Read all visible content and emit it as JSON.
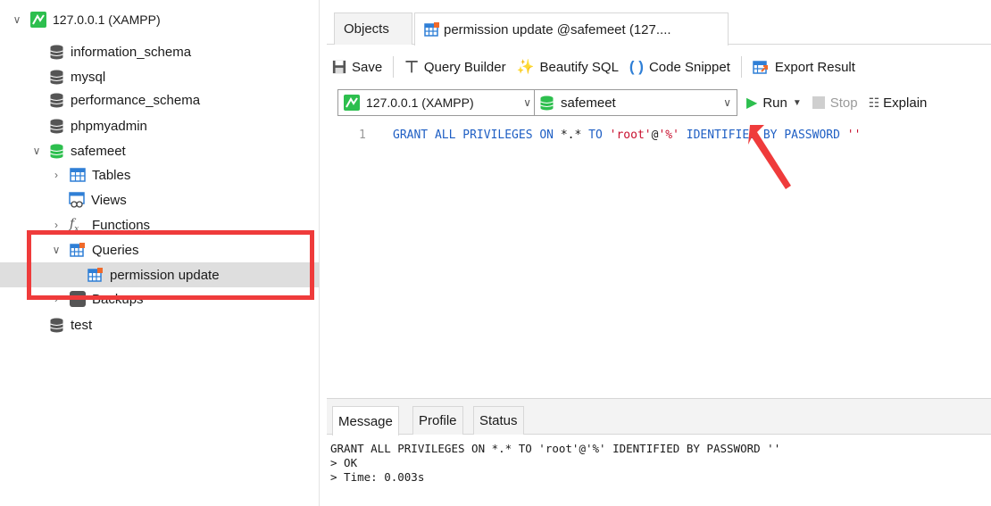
{
  "sidebar": {
    "connection": "127.0.0.1 (XAMPP)",
    "databases": {
      "information_schema": "information_schema",
      "mysql": "mysql",
      "performance_schema": "performance_schema",
      "phpmyadmin": "phpmyadmin",
      "safemeet": "safemeet",
      "test": "test"
    },
    "safemeet_children": {
      "tables": "Tables",
      "views": "Views",
      "functions": "Functions",
      "queries": "Queries",
      "query_item": "permission update",
      "backups": "Backups"
    }
  },
  "tabs": {
    "objects": "Objects",
    "query_tab": "permission update @safemeet (127...."
  },
  "toolbar": {
    "save": "Save",
    "query_builder": "Query Builder",
    "beautify": "Beautify SQL",
    "code_snippet": "Code Snippet",
    "export": "Export Result"
  },
  "connrow": {
    "connection_select": "127.0.0.1 (XAMPP)",
    "database_select": "safemeet",
    "run": "Run",
    "stop": "Stop",
    "explain": "Explain"
  },
  "editor": {
    "line_number": "1",
    "kw1": "GRANT ALL PRIVILEGES ON ",
    "star": "*.*",
    "kw2": " TO ",
    "user": "'root'",
    "at": "@",
    "host": "'%'",
    "kw3": " IDENTIFIED BY PASSWORD ",
    "pwd": "''"
  },
  "message": {
    "tabs": [
      "Message",
      "Profile",
      "Status"
    ],
    "line1": "GRANT ALL PRIVILEGES ON *.* TO 'root'@'%' IDENTIFIED BY PASSWORD ''",
    "line2": "> OK",
    "line3": "> Time: 0.003s"
  },
  "colors": {
    "accent_green": "#2dbf4e",
    "highlight_red": "#ef3b3b",
    "keyword_blue": "#1f5fc4",
    "string_red": "#c8102e"
  }
}
